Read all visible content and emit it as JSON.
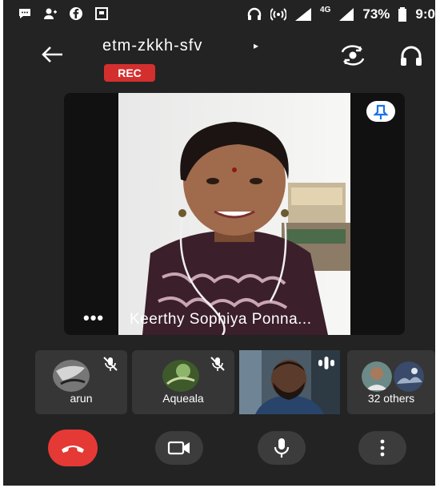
{
  "status_bar": {
    "network_label": "4G",
    "battery": "73%",
    "time": "9:0"
  },
  "header": {
    "meeting_code": "etm-zkkh-sfv",
    "caret": "▸",
    "rec_label": "REC"
  },
  "main_tile": {
    "more_label": "•••",
    "participant_name": "Keerthy Sophiya Ponna..."
  },
  "participants": [
    {
      "name": "arun",
      "muted": true
    },
    {
      "name": "Aqueala",
      "muted": true
    },
    {
      "name": "",
      "video": true,
      "speaking": true
    },
    {
      "name": "32 others"
    }
  ],
  "colors": {
    "background": "#232323",
    "rec": "#d32f2f",
    "hangup": "#e53935",
    "pin": "#1a73e8"
  },
  "icons": [
    "back-arrow-icon",
    "switch-camera-icon",
    "headphones-icon",
    "pin-icon",
    "mic-off-icon",
    "end-call-icon",
    "video-camera-icon",
    "microphone-icon",
    "more-vert-icon"
  ]
}
